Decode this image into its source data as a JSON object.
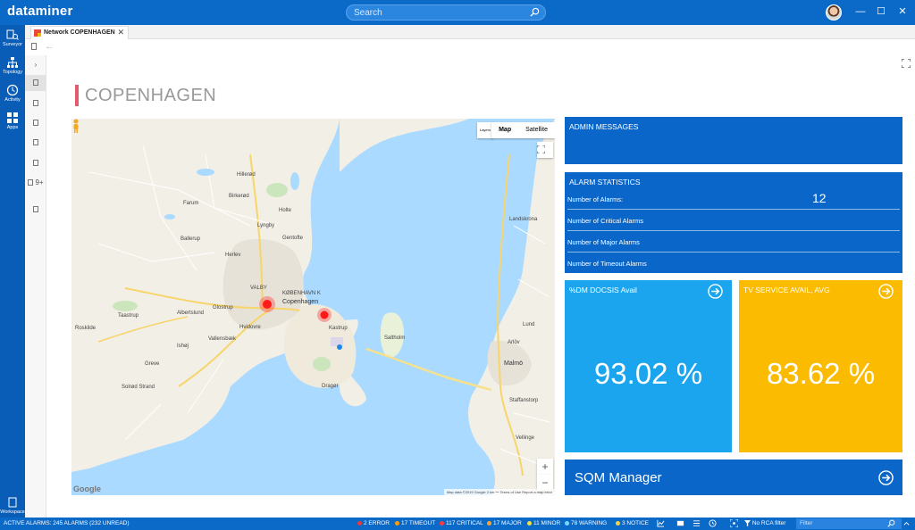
{
  "app": {
    "logo": "dataminer"
  },
  "search": {
    "placeholder": "Search"
  },
  "window": {
    "minimize": "—",
    "maximize": "☐",
    "close": "✕"
  },
  "leftnav": {
    "items": [
      {
        "label": "Surveyor",
        "icon": "surveyor-icon"
      },
      {
        "label": "Topology",
        "icon": "topology-icon"
      },
      {
        "label": "Activity",
        "icon": "activity-icon"
      },
      {
        "label": "Apps",
        "icon": "apps-icon"
      }
    ],
    "bottom": {
      "label": "Workspace",
      "icon": "workspace-icon"
    }
  },
  "tabs": [
    {
      "label": "Network COPENHAGEN",
      "close": "✕"
    }
  ],
  "sidepanel": {
    "badge": "9+",
    "chevron": "›"
  },
  "page": {
    "title": "COPENHAGEN"
  },
  "map": {
    "type_map": "Map",
    "type_satellite": "Satellite",
    "layers": "Layers",
    "zoom_in": "+",
    "zoom_out": "−",
    "google": "Google",
    "attribution": "Map data ©2019 Google   2 km ⎯⎯   Terms of Use   Report a map error",
    "labels": {
      "copenhagen": "Copenhagen",
      "malmo": "Malmö",
      "lyngby": "Lyngby",
      "gentofte": "Gentofte",
      "ballerup": "Ballerup",
      "albertslund": "Albertslund",
      "glostrup": "Glostrup",
      "herlev": "Herlev",
      "vallensbaek": "Vallensbæk",
      "ishoj": "Ishøj",
      "greve": "Greve",
      "saltholm": "Saltholm",
      "dragor": "Dragør",
      "kastrup": "Kastrup",
      "helsingborg": "",
      "landskrona": "Landskrona",
      "lund": "Lund",
      "hvidovre": "Hvidovre",
      "kobenhavn_k": "KØBENHAVN K",
      "valby": "VALBY",
      "hillerod": "Hillerød",
      "farum": "Farum",
      "birkerod": "Birkerød",
      "holte": "Holte",
      "roskilde": "Roskilde",
      "taastrup": "Taastrup",
      "solrod": "Solrød Strand",
      "vellinge": "Vellinge",
      "arlov": "Arlöv",
      "staffanstorp": "Staffanstorp"
    }
  },
  "widgets": {
    "admin": {
      "title": "ADMIN MESSAGES"
    },
    "alarm_stats": {
      "title": "ALARM STATISTICS",
      "rows": [
        {
          "label": "Number of Alarms:",
          "value": "12"
        },
        {
          "label": "Number of Critical Alarms",
          "value": ""
        },
        {
          "label": "Number of Major Alarms",
          "value": ""
        },
        {
          "label": "Number of Timeout Alarms",
          "value": ""
        }
      ]
    },
    "docsis": {
      "title": "%DM DOCSIS Avail",
      "value": "93.02 %",
      "color": "#1aa5ee"
    },
    "tv": {
      "title": "TV SERVICE AVAIL, AVG",
      "value": "83.62 %",
      "color": "#fbbb00"
    },
    "sqm": {
      "label": "SQM Manager"
    }
  },
  "statusbar": {
    "active_alarms": "ACTIVE ALARMS: 245 ALARMS (232 UNREAD)",
    "error": "2 ERROR",
    "timeout": "17 TIMEOUT",
    "critical": "117 CRITICAL",
    "major": "17 MAJOR",
    "minor": "11 MINOR",
    "warning": "78 WARNING",
    "notice": "3 NOTICE",
    "rca": "No RCA filter",
    "filter_placeholder": "Filter",
    "colors": {
      "error": "#e83a3a",
      "timeout": "#ff9d00",
      "critical": "#ff3b3b",
      "major": "#ffa629",
      "minor": "#f1e04a",
      "warning": "#7ad5ff",
      "notice": "#f5d23d"
    }
  }
}
